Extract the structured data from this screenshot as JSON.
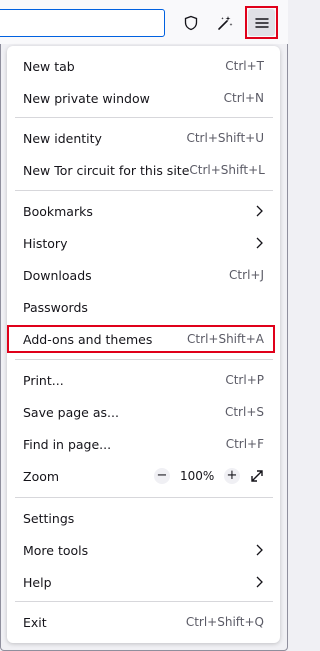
{
  "toolbar": {
    "icons": [
      "shield-icon",
      "magic-wand-icon",
      "hamburger-menu-icon"
    ]
  },
  "menu": {
    "items": [
      {
        "label": "New tab",
        "shortcut": "Ctrl+T"
      },
      {
        "label": "New private window",
        "shortcut": "Ctrl+N"
      },
      {
        "label": "New identity",
        "shortcut": "Ctrl+Shift+U"
      },
      {
        "label": "New Tor circuit for this site",
        "shortcut": "Ctrl+Shift+L"
      },
      {
        "label": "Bookmarks",
        "submenu": true
      },
      {
        "label": "History",
        "submenu": true
      },
      {
        "label": "Downloads",
        "shortcut": "Ctrl+J"
      },
      {
        "label": "Passwords"
      },
      {
        "label": "Add-ons and themes",
        "shortcut": "Ctrl+Shift+A"
      },
      {
        "label": "Print...",
        "shortcut": "Ctrl+P"
      },
      {
        "label": "Save page as...",
        "shortcut": "Ctrl+S"
      },
      {
        "label": "Find in page...",
        "shortcut": "Ctrl+F"
      },
      {
        "label": "Zoom"
      },
      {
        "label": "Settings"
      },
      {
        "label": "More tools",
        "submenu": true
      },
      {
        "label": "Help",
        "submenu": true
      },
      {
        "label": "Exit",
        "shortcut": "Ctrl+Shift+Q"
      }
    ],
    "zoom": {
      "minus": "−",
      "value": "100%",
      "plus": "+"
    }
  },
  "colors": {
    "highlight": "#e0001a",
    "url_border": "#0061e0"
  }
}
